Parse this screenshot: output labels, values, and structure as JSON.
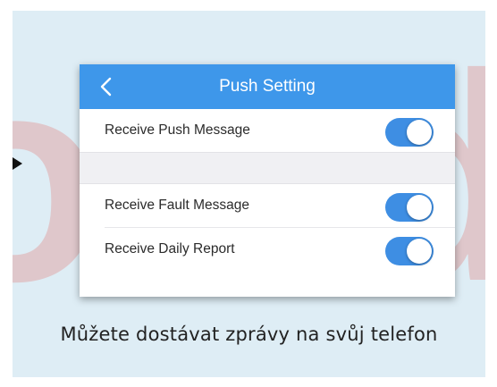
{
  "colors": {
    "slide_background": "#deedf5",
    "header_blue": "#3e97ea",
    "toggle_on": "#3e8ee3",
    "watermark": "#e35a50"
  },
  "watermark": {
    "left_glyph": "o",
    "right_glyph": "d"
  },
  "header": {
    "back_icon": "chevron-left-icon",
    "title": "Push Setting"
  },
  "settings": [
    {
      "label": "Receive Push Message",
      "enabled": true
    },
    {
      "label": "Receive Fault Message",
      "enabled": true
    },
    {
      "label": "Receive Daily Report",
      "enabled": true
    }
  ],
  "caption": "Můžete dostávat zprávy na svůj telefon"
}
